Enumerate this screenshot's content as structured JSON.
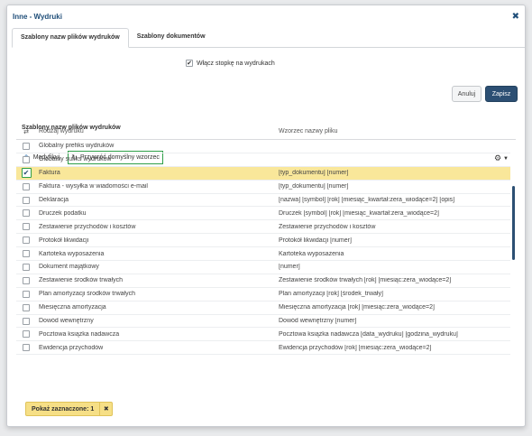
{
  "window": {
    "title": "Inne - Wydruki"
  },
  "tabs": [
    {
      "label": "Szablony nazw plików wydruków",
      "active": true
    },
    {
      "label": "Szablony dokumentów",
      "active": false
    }
  ],
  "options": {
    "footer_checkbox_label": "Włącz stopkę na wydrukach",
    "footer_checked": true
  },
  "buttons": {
    "cancel": "Anuluj",
    "save": "Zapisz"
  },
  "section": {
    "title": "Szablony nazw plików wydruków"
  },
  "toolbar": {
    "modify": "Modyfikuj",
    "restore": "Przywróć domyślny wzorzec"
  },
  "table": {
    "headers": {
      "type": "Rodzaj wydruku",
      "pattern": "Wzorzec nazwy pliku"
    },
    "rows": [
      {
        "type": "Globalny prefiks wydruków",
        "pattern": "",
        "checked": false
      },
      {
        "type": "Globalny sufiks wydruków",
        "pattern": "",
        "checked": false
      },
      {
        "type": "Faktura",
        "pattern": "[typ_dokumentu] [numer]",
        "checked": true
      },
      {
        "type": "Faktura - wysyłka w wiadomości e-mail",
        "pattern": "[typ_dokumentu] [numer]",
        "checked": false
      },
      {
        "type": "Deklaracja",
        "pattern": "[nazwa] [symbol] [rok] [miesiąc_kwartał:zera_wiodące=2] [opis]",
        "checked": false
      },
      {
        "type": "Druczek podatku",
        "pattern": "Druczek [symbol] [rok] [miesiąc_kwartał:zera_wiodące=2]",
        "checked": false
      },
      {
        "type": "Zestawienie przychodów i kosztów",
        "pattern": "Zestawienie przychodów i kosztów",
        "checked": false
      },
      {
        "type": "Protokół likwidacji",
        "pattern": "Protokół likwidacji [numer]",
        "checked": false
      },
      {
        "type": "Kartoteka wyposażenia",
        "pattern": "Kartoteka wyposażenia",
        "checked": false
      },
      {
        "type": "Dokument majątkowy",
        "pattern": "[numer]",
        "checked": false
      },
      {
        "type": "Zestawienie środków trwałych",
        "pattern": "Zestawienie środków trwałych [rok] [miesiąc:zera_wiodące=2]",
        "checked": false
      },
      {
        "type": "Plan amortyzacji środków trwałych",
        "pattern": "Plan amortyzacji [rok] [środek_trwały]",
        "checked": false
      },
      {
        "type": "Miesięczna amortyzacja",
        "pattern": "Miesięczna amortyzacja [rok] [miesiąc:zera_wiodące=2]",
        "checked": false
      },
      {
        "type": "Dowód wewnętrzny",
        "pattern": "Dowód wewnętrzny [numer]",
        "checked": false
      },
      {
        "type": "Pocztowa książka nadawcza",
        "pattern": "Pocztowa książka nadawcza [data_wydruku] [godzina_wydruku]",
        "checked": false
      },
      {
        "type": "Ewidencja przychodów",
        "pattern": "Ewidencja przychodów [rok] [miesiąc:zera_wiodące=2]",
        "checked": false
      }
    ]
  },
  "selection_badge": {
    "label": "Pokaż zaznaczone: 1"
  },
  "colors": {
    "accent": "#2c4f73",
    "selected_row": "#f9e79a",
    "highlight_border": "#2e9e48"
  }
}
